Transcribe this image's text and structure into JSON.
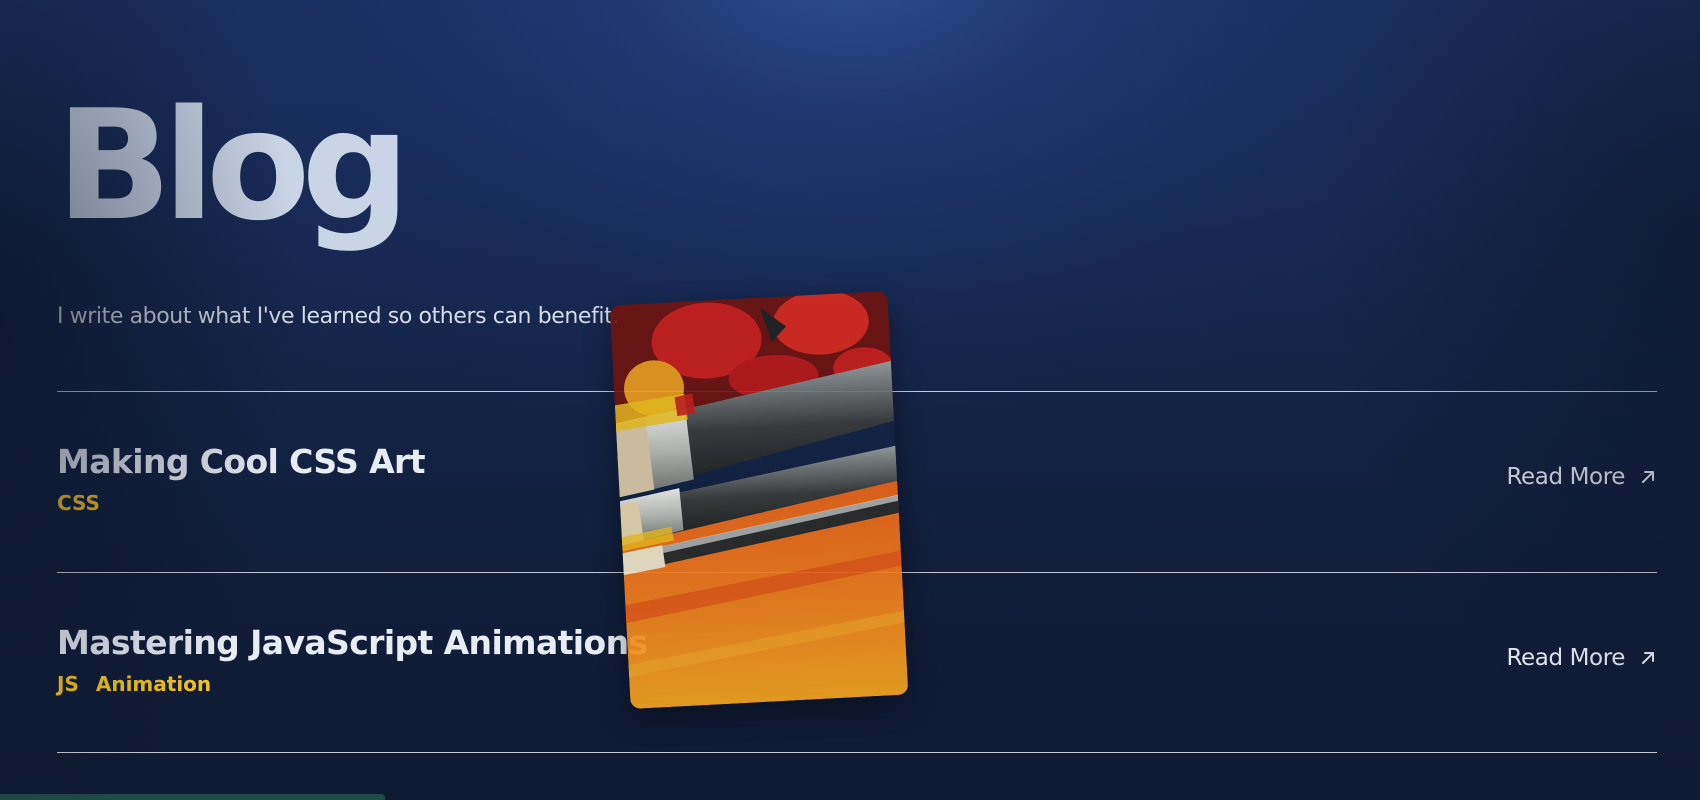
{
  "header": {
    "title": "Blog",
    "subtitle": "I write about what I've learned so others can benefit."
  },
  "posts": [
    {
      "title": "Making Cool CSS Art",
      "tags": [
        "CSS"
      ],
      "read_more_label": "Read More",
      "read_more_icon": "arrow-up-right-icon"
    },
    {
      "title": "Mastering JavaScript Animations",
      "tags": [
        "JS",
        "Animation"
      ],
      "read_more_label": "Read More",
      "read_more_icon": "arrow-up-right-icon"
    }
  ],
  "hover_preview": {
    "image": "paint-brushes-image"
  },
  "colors": {
    "background": "#15254a",
    "title": "#c9d4e6",
    "text": "#e6ebf5",
    "tag": "#f5c51c",
    "divider": "#e6ebf5"
  }
}
